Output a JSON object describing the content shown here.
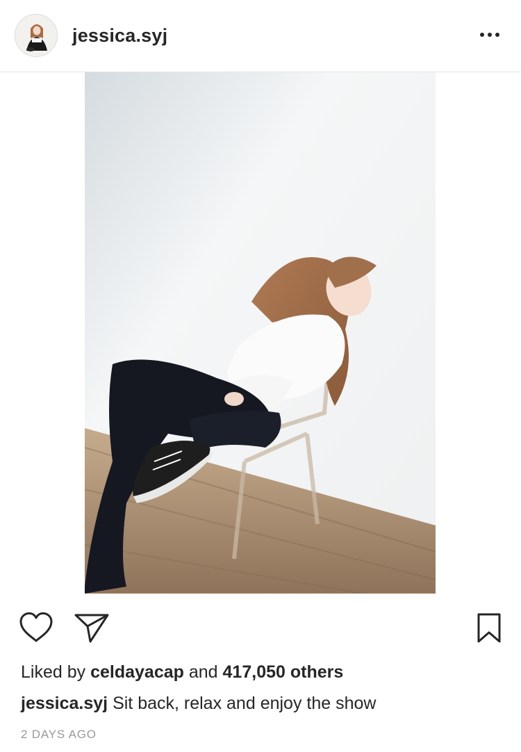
{
  "post": {
    "username": "jessica.syj",
    "likes_prefix": "Liked by",
    "liked_by_user": "celdayacap",
    "likes_connector": "and",
    "likes_count": "417,050 others",
    "caption_user": "jessica.syj",
    "caption_text": "Sit back, relax and enjoy the show",
    "timestamp": "2 DAYS AGO"
  },
  "icons": {
    "more": "more-options-icon",
    "like": "heart-icon",
    "share": "paper-plane-icon",
    "save": "bookmark-icon"
  },
  "colors": {
    "text": "#262626",
    "muted": "#999999",
    "divider": "#e6e6e6"
  }
}
